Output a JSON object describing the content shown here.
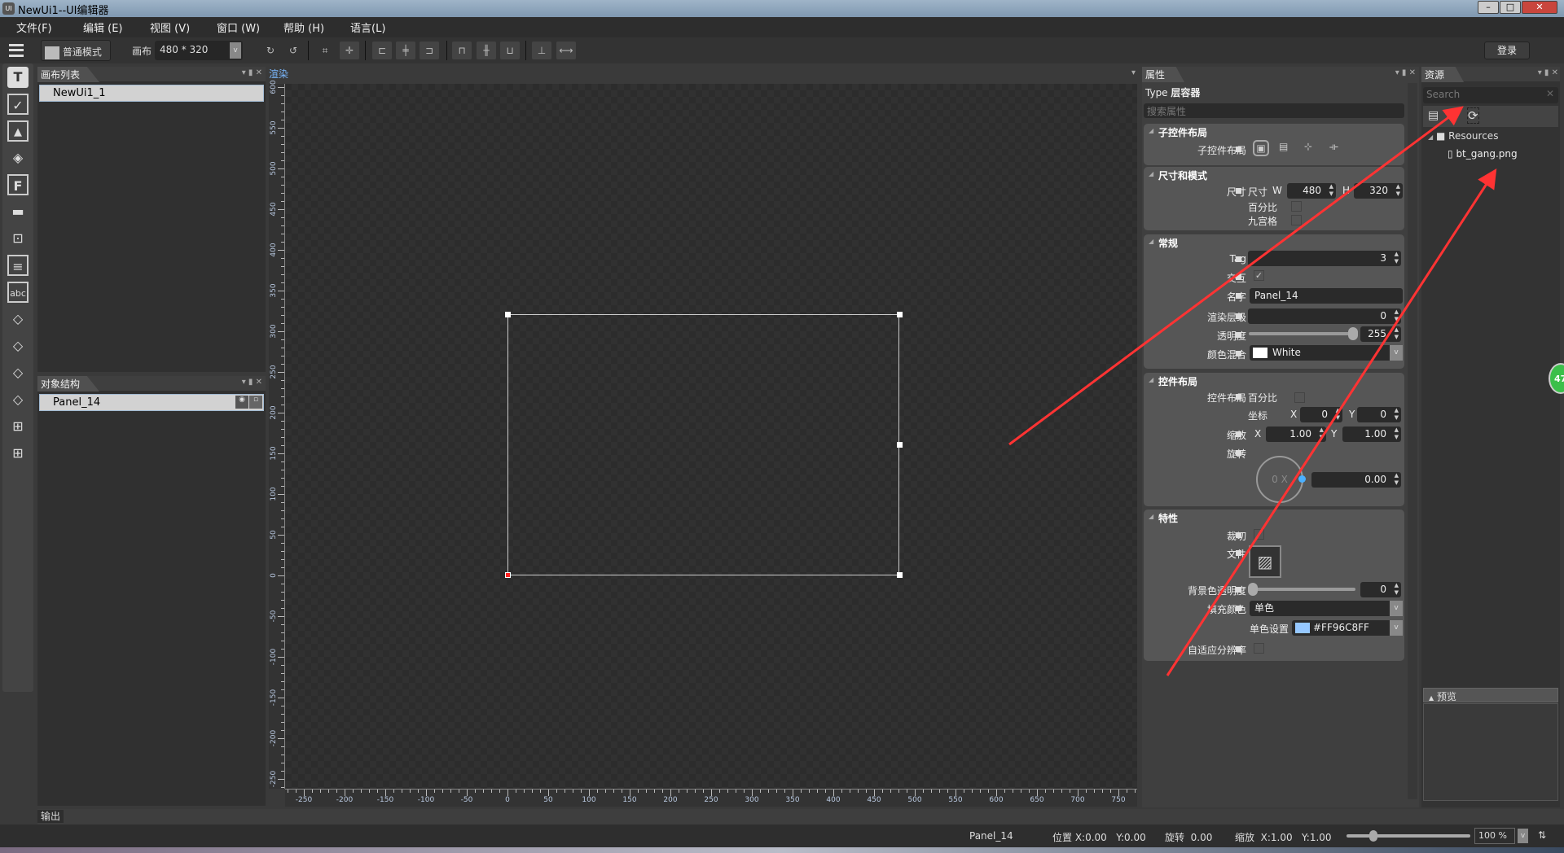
{
  "window": {
    "title": "NewUi1--UI编辑器",
    "icon": "UI",
    "minimize": "–",
    "maximize": "□",
    "close": "✕"
  },
  "menu": [
    "文件(F)",
    "编辑 (E)",
    "视图 (V)",
    "窗口 (W)",
    "帮助 (H)",
    "语言(L)"
  ],
  "toolbar": {
    "mode_label": "普通模式",
    "canvas_label": "画布",
    "canvas_size": "480 * 320",
    "login": "登录"
  },
  "left_tools": [
    "text",
    "checkbox",
    "image",
    "tag",
    "font",
    "progress-bar",
    "slider",
    "list",
    "input",
    "layer",
    "layer-edit",
    "layer-list",
    "layer-image",
    "grid",
    "grid-alt"
  ],
  "canvas_list": {
    "title": "画布列表",
    "items": [
      "NewUi1_1"
    ]
  },
  "object_tree": {
    "title": "对象结构",
    "items": [
      "Panel_14"
    ]
  },
  "render": {
    "title": "渲染",
    "x_ticks": [
      "-250",
      "-200",
      "-150",
      "-100",
      "-50",
      "0",
      "50",
      "100",
      "150",
      "200",
      "250",
      "300",
      "350",
      "400",
      "450",
      "500",
      "550",
      "600",
      "650",
      "700",
      "750"
    ],
    "y_ticks": [
      "600",
      "550",
      "500",
      "450",
      "400",
      "350",
      "300",
      "250",
      "200",
      "150",
      "100",
      "50",
      "0",
      "-50",
      "-100",
      "-150",
      "-200",
      "-250"
    ],
    "panel_w": 480,
    "panel_h": 320
  },
  "output": {
    "title": "输出"
  },
  "props": {
    "title": "属性",
    "type_label": "Type",
    "type_value": "层容器",
    "search_placeholder": "搜索属性",
    "child_layout": {
      "title": "子控件布局",
      "label": "子控件布局"
    },
    "size": {
      "title": "尺寸和模式",
      "label": "尺寸",
      "sub": "尺寸",
      "w": "W",
      "w_val": "480",
      "h": "H",
      "h_val": "320",
      "percent": "百分比",
      "nine": "九宫格"
    },
    "general": {
      "title": "常规",
      "tag": "Tag",
      "tag_val": "3",
      "interact": "交互",
      "interact_val": "✓",
      "name": "名字",
      "name_val": "Panel_14",
      "zorder": "渲染层级",
      "zorder_val": "0",
      "alpha": "透明度",
      "alpha_val": "255",
      "blend": "颜色混合",
      "blend_val": "White"
    },
    "layout": {
      "title": "控件布局",
      "label": "控件布局",
      "percent": "百分比",
      "pos": "坐标",
      "x": "X",
      "y": "Y",
      "pos_x": "0",
      "pos_y": "0",
      "scale": "缩放",
      "scale_x": "1.00",
      "scale_y": "1.00",
      "rotate": "旋转",
      "rotate_dial": "0 X",
      "rotate_val": "0.00"
    },
    "feature": {
      "title": "特性",
      "clip": "裁切",
      "file": "文件",
      "bg_alpha": "背景色透明度",
      "bg_alpha_val": "0",
      "fill": "填充颜色",
      "fill_val": "单色",
      "mono": "单色设置",
      "mono_val": "#FF96C8FF",
      "mono_color": "#96C8FF",
      "adapt": "自适应分辨率"
    }
  },
  "resources": {
    "title": "资源",
    "search_placeholder": "Search",
    "root": "Resources",
    "files": [
      "bt_gang.png"
    ],
    "preview": "预览"
  },
  "status": {
    "name": "Panel_14",
    "pos": "位置 X:0.00   Y:0.00",
    "rotate": "旋转  0.00",
    "scale": "缩放  X:1.00   Y:1.00",
    "zoom": "100 %",
    "zoom_level": 0.2
  },
  "badge": "47",
  "annotation_color": "#ff3333"
}
